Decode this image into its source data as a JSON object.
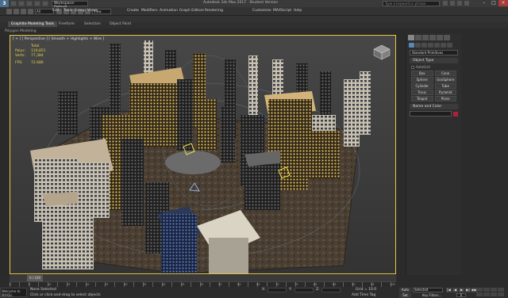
{
  "titlebar": {
    "workspace": "Workspace: Default",
    "title": "Autodesk 3ds Max 2017 · Student Version",
    "search_placeholder": "Type a keyword or phrase"
  },
  "menu": {
    "items": [
      "Edit",
      "Tools",
      "Group",
      "Views",
      "Create",
      "Modifiers",
      "Animation",
      "Graph Editors",
      "Rendering",
      "Customize",
      "MAXScript",
      "Help"
    ]
  },
  "toolbar": {
    "selection_filter": "All",
    "view_select": "View"
  },
  "ribbon": {
    "tabs": [
      "Graphite Modeling Tools",
      "Freeform",
      "Selection",
      "Object Paint"
    ],
    "sub_label": "Polygon Modeling"
  },
  "viewport": {
    "label": "[ + ] [ Perspective ] [ Smooth + Highlights + Wire ]",
    "stats": {
      "total_label": "Total",
      "polys_label": "Polys:",
      "polys": "116,851",
      "verts_label": "Verts:",
      "verts": "77,384",
      "fps_label": "FPS:",
      "fps": "72.686"
    }
  },
  "command_panel": {
    "category": "Standard Primitives",
    "object_type_title": "Object Type",
    "autogrid": "AutoGrid",
    "objects": [
      "Box",
      "Cone",
      "Sphere",
      "GeoSphere",
      "Cylinder",
      "Tube",
      "Torus",
      "Pyramid",
      "Teapot",
      "Plane"
    ],
    "name_color_title": "Name and Color",
    "swatch_color": "#b0203a"
  },
  "timeline": {
    "slider": "0 / 100",
    "ticks": [
      "0",
      "5",
      "10",
      "15",
      "20",
      "25",
      "30",
      "35",
      "40",
      "45",
      "50",
      "55",
      "60",
      "65",
      "70",
      "75",
      "80",
      "85",
      "90",
      "95",
      "100"
    ]
  },
  "status": {
    "welcome": "Welcome to MAXSc",
    "line1": "None Selected",
    "line2": "Click or click-and-drag to select objects",
    "x_label": "X:",
    "y_label": "Y:",
    "z_label": "Z:",
    "grid": "Grid = 10.0",
    "add_time_tag": "Add Time Tag",
    "auto_key": "Auto Key",
    "set_key": "Set Key",
    "selected": "Selected",
    "key_filters": "Key Filters...",
    "frame": "0"
  }
}
